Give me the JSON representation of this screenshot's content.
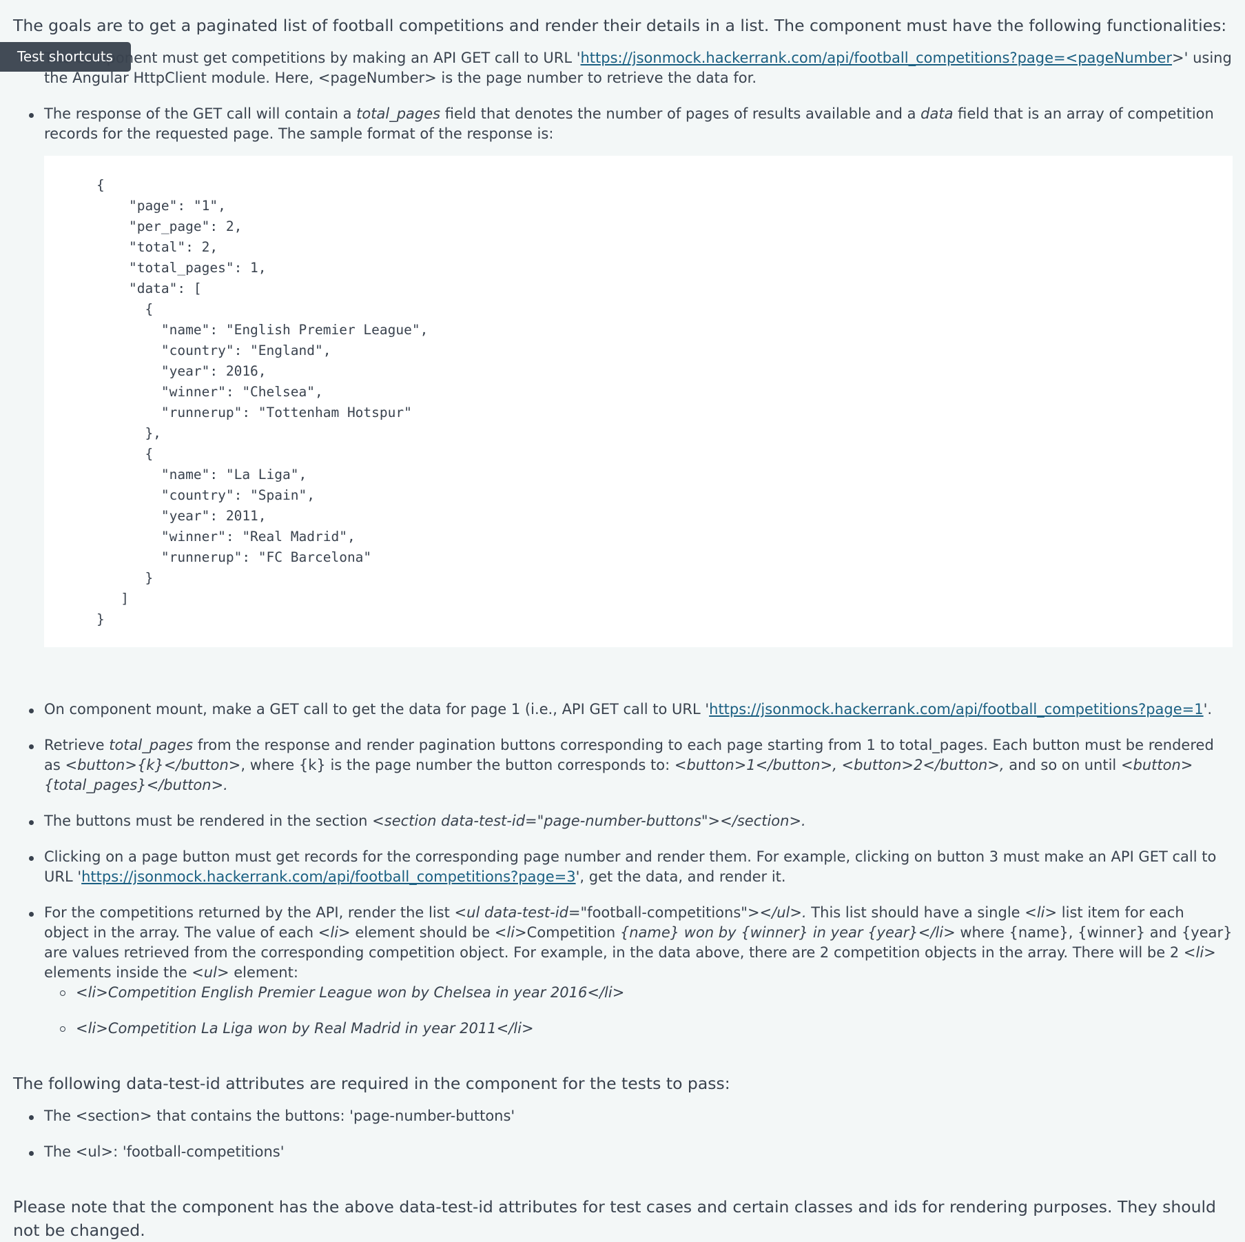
{
  "intro": "The goals are to get a paginated list of football competitions and render their details in a list. The component must have the following functionalities:",
  "tooltip": "Test shortcuts",
  "bullet1": {
    "pre": "The component must get competitions by making an API GET call to URL '",
    "link": "https://jsonmock.hackerrank.com/api/football_competitions?page=<pageNumber",
    "post1": ">' using the Angular",
    "post2": "HttpClient module. Here, <pageNumber> is the page number to retrieve the data for."
  },
  "bullet2": {
    "p1": "The response of the GET call will contain a ",
    "em1": "total_pages",
    "p2": " field that denotes the number of pages of results available and a ",
    "em2": "data",
    "p3": " field that is an array of competition records for the requested page. The sample format of the response is:"
  },
  "code_sample": "{\n    \"page\": \"1\",\n    \"per_page\": 2,\n    \"total\": 2,\n    \"total_pages\": 1,\n    \"data\": [\n      {\n        \"name\": \"English Premier League\",\n        \"country\": \"England\",\n        \"year\": 2016,\n        \"winner\": \"Chelsea\",\n        \"runnerup\": \"Tottenham Hotspur\"\n      },\n      {\n        \"name\": \"La Liga\",\n        \"country\": \"Spain\",\n        \"year\": 2011,\n        \"winner\": \"Real Madrid\",\n        \"runnerup\": \"FC Barcelona\"\n      }\n   ]\n}",
  "bullet3": {
    "pre": "On component mount, make a GET call to get the data for page 1 (i.e., API GET call to URL '",
    "link": "https://jsonmock.hackerrank.com/api/football_competitions?page=1",
    "post": "'."
  },
  "bullet4": {
    "p1": "Retrieve ",
    "em1": "total_pages",
    "p2": " from the response and render pagination buttons corresponding to each page starting from 1 to total_pages. Each button must be rendered as ",
    "em2": "<button>{k}</button>",
    "p3": ", where {k} is the page number the button corresponds to:  ",
    "em3": "<button>1</button>, <button>2</button>,",
    "p4": " and so on until ",
    "em4": "<button>{total_pages}</button>."
  },
  "bullet5": {
    "p1": "The buttons must be rendered in the section ",
    "em1": "<section data-test-id=\"page-number-buttons\"></section>."
  },
  "bullet6": {
    "pre": "Clicking on a page button must get records for the corresponding page number and render them. For example, clicking on button 3 must make an API GET call to URL '",
    "link": "https://jsonmock.hackerrank.com/api/football_competitions?page=3",
    "post": "', get the data, and render it."
  },
  "bullet7": {
    "p1": "For the competitions returned by the API, render the list ",
    "em1": "<ul data-test-id=\"",
    "p2": "football-competitions",
    "em2": "\"></ul>.",
    "p3": " This list should have a single ",
    "em3": "<li>",
    "p4": " list item for each object in the array. The value of each ",
    "em4": "<li>",
    "p5": " element should be ",
    "em5": "<li>",
    "p6": "Competition ",
    "em6": "{name} won by {winner} in year {year}</li>",
    "p7": " where {name}, {winner} and {year} are values retrieved from the corresponding competition object.  For example, in the data above, there are 2 competition objects in the array. There will be 2 ",
    "em7": "<li>",
    "p8": " elements inside the ",
    "em8": "<ul>",
    "p9": " element:",
    "sub": [
      "<li>Competition English Premier League won by Chelsea in year 2016</li>",
      "<li>Competition La Liga won by Real Madrid in year 2011</li>"
    ]
  },
  "attrs_heading": "The following data-test-id attributes are required in the component for the tests to pass:",
  "attrs": [
    "The <section> that contains the buttons: 'page-number-buttons'",
    "The <ul>: 'football-competitions'"
  ],
  "note": "Please note that the component has the above data-test-id attributes for test cases and certain classes and ids for rendering purposes. They should not be changed."
}
